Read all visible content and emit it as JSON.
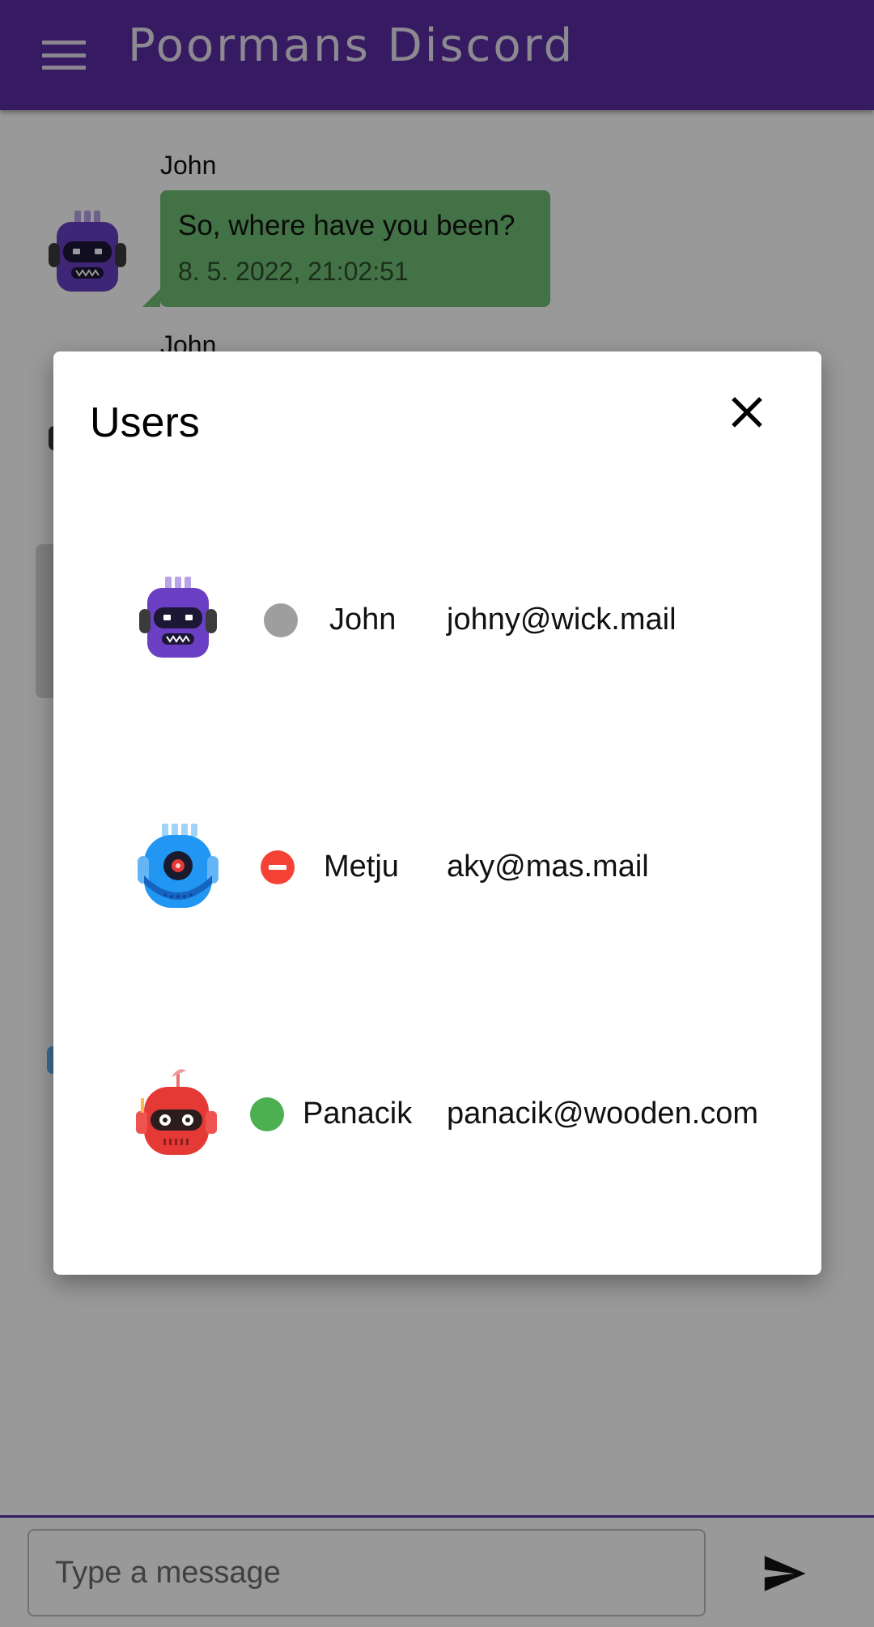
{
  "app": {
    "title": "Poormans Discord"
  },
  "chat": {
    "messages": [
      {
        "sender": "John",
        "text": "So, where have you been?",
        "timestamp": "8. 5. 2022, 21:02:51",
        "avatar": "purple-robot-icon"
      },
      {
        "sender": "John",
        "avatar": "purple-robot-icon"
      }
    ]
  },
  "composer": {
    "placeholder": "Type a message",
    "value": "",
    "send_icon": "send-icon"
  },
  "dialog": {
    "title": "Users",
    "close_icon": "close-icon",
    "users": [
      {
        "name": "John",
        "email": "johny@wick.mail",
        "status": "offline",
        "status_color": "#9e9e9e",
        "avatar": "purple-robot-icon"
      },
      {
        "name": "Metju",
        "email": "aky@mas.mail",
        "status": "do-not-disturb",
        "status_color": "#f44336",
        "avatar": "blue-robot-icon"
      },
      {
        "name": "Panacik",
        "email": "panacik@wooden.com",
        "status": "online",
        "status_color": "#4caf50",
        "avatar": "red-robot-icon"
      }
    ]
  },
  "colors": {
    "primary": "#5b2ea6",
    "bubble": "#6fbf73",
    "scrim": "rgba(0,0,0,0.4)"
  }
}
